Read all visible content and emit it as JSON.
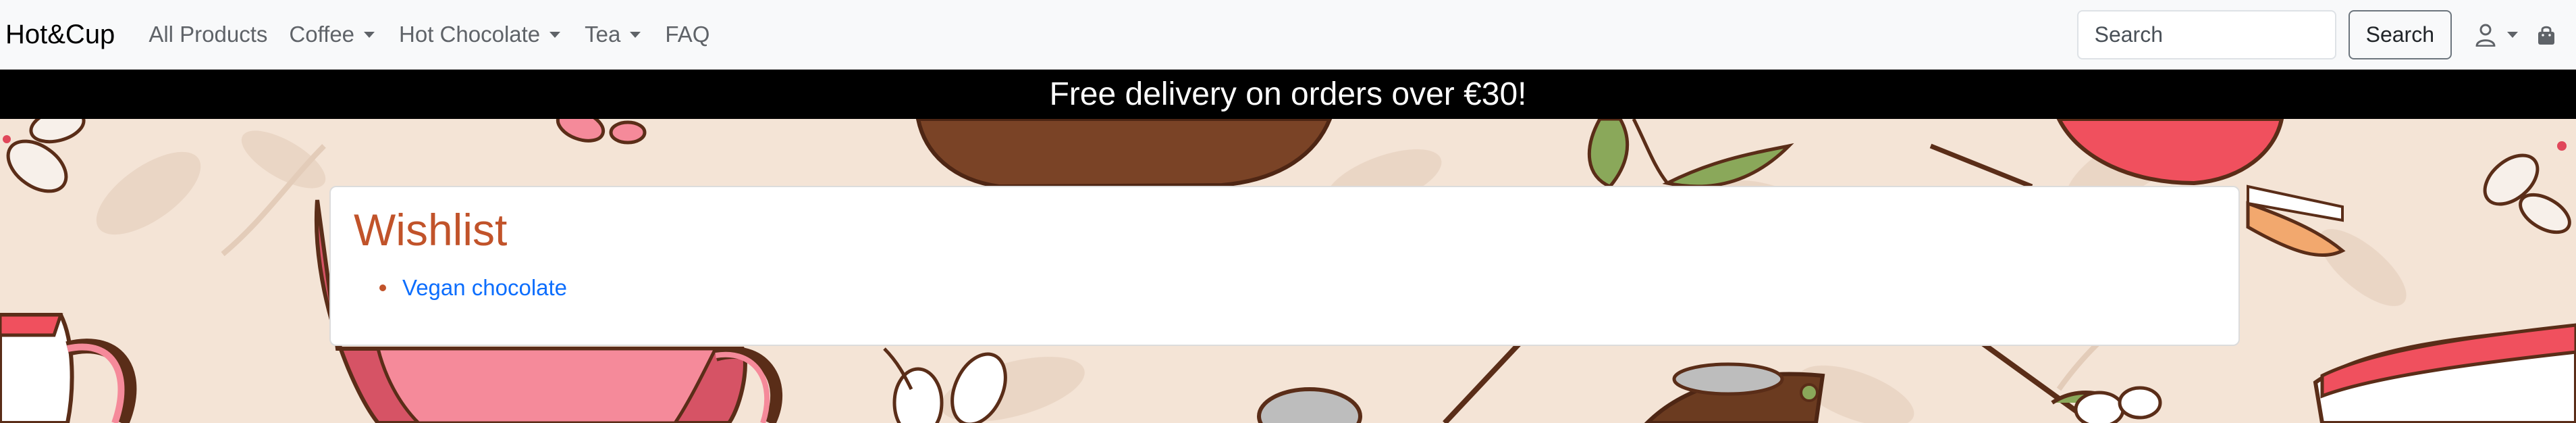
{
  "navbar": {
    "brand": "Hot&Cup",
    "links": [
      {
        "label": "All Products",
        "dropdown": false
      },
      {
        "label": "Coffee",
        "dropdown": true
      },
      {
        "label": "Hot Chocolate",
        "dropdown": true
      },
      {
        "label": "Tea",
        "dropdown": true
      },
      {
        "label": "FAQ",
        "dropdown": false
      }
    ],
    "search": {
      "placeholder": "Search",
      "button_label": "Search"
    },
    "icons": {
      "account": "user-icon",
      "cart": "shopping-bag-icon"
    }
  },
  "banner": {
    "text": "Free delivery on orders over €30!"
  },
  "wishlist": {
    "title": "Wishlist",
    "items": [
      {
        "label": "Vegan chocolate"
      }
    ]
  },
  "colors": {
    "accent": "#c1532a",
    "link": "#0d6efd",
    "navbar_bg": "#f8f9fa",
    "banner_bg": "#000000",
    "page_bg": "#f4e4d6"
  }
}
